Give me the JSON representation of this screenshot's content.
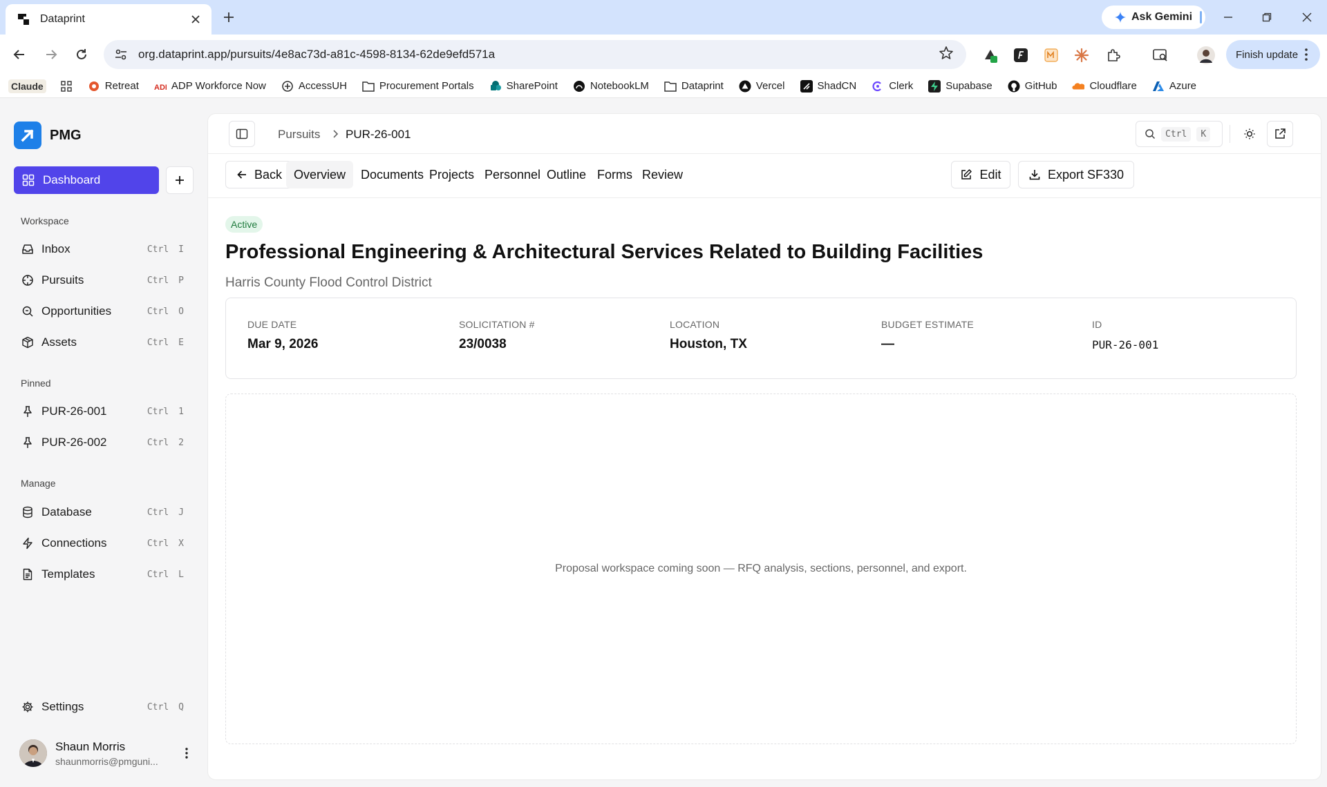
{
  "browser": {
    "tab_title": "Dataprint",
    "url": "org.dataprint.app/pursuits/4e8ac73d-a81c-4598-8134-62de9efd571a",
    "gemini_label": "Ask Gemini",
    "finish_update_label": "Finish update",
    "bookmarks": [
      "Claude",
      "Retreat",
      "ADP Workforce Now",
      "AccessUH",
      "Procurement Portals",
      "SharePoint",
      "NotebookLM",
      "Dataprint",
      "Vercel",
      "ShadCN",
      "Clerk",
      "Supabase",
      "GitHub",
      "Cloudflare",
      "Azure"
    ]
  },
  "sidebar": {
    "brand": "PMG",
    "dashboard_label": "Dashboard",
    "workspace_label": "Workspace",
    "workspace_items": [
      {
        "label": "Inbox",
        "mod": "Ctrl",
        "key": "I",
        "icon": "inbox-icon"
      },
      {
        "label": "Pursuits",
        "mod": "Ctrl",
        "key": "P",
        "icon": "crosshair-icon"
      },
      {
        "label": "Opportunities",
        "mod": "Ctrl",
        "key": "O",
        "icon": "search-icon"
      },
      {
        "label": "Assets",
        "mod": "Ctrl",
        "key": "E",
        "icon": "box-icon"
      }
    ],
    "pinned_label": "Pinned",
    "pinned_items": [
      {
        "label": "PUR-26-001",
        "mod": "Ctrl",
        "key": "1"
      },
      {
        "label": "PUR-26-002",
        "mod": "Ctrl",
        "key": "2"
      }
    ],
    "manage_label": "Manage",
    "manage_items": [
      {
        "label": "Database",
        "mod": "Ctrl",
        "key": "J",
        "icon": "database-icon"
      },
      {
        "label": "Connections",
        "mod": "Ctrl",
        "key": "X",
        "icon": "zap-icon"
      },
      {
        "label": "Templates",
        "mod": "Ctrl",
        "key": "L",
        "icon": "file-text-icon"
      }
    ],
    "settings": {
      "label": "Settings",
      "mod": "Ctrl",
      "key": "Q"
    },
    "user": {
      "name": "Shaun Morris",
      "email": "shaunmorris@pmguni..."
    }
  },
  "header": {
    "breadcrumb_root": "Pursuits",
    "breadcrumb_current": "PUR-26-001",
    "search_mod": "Ctrl",
    "search_key": "K"
  },
  "tabs": {
    "back_label": "Back",
    "items": [
      "Overview",
      "Documents",
      "Projects",
      "Personnel",
      "Outline",
      "Forms",
      "Review"
    ],
    "active": "Overview",
    "edit_label": "Edit",
    "export_label": "Export SF330"
  },
  "pursuit": {
    "status": "Active",
    "title": "Professional Engineering & Architectural Services Related to Building Facilities",
    "organization": "Harris County Flood Control District",
    "meta": [
      {
        "label": "DUE DATE",
        "value": "Mar 9, 2026"
      },
      {
        "label": "SOLICITATION #",
        "value": "23/0038"
      },
      {
        "label": "LOCATION",
        "value": "Houston, TX"
      },
      {
        "label": "BUDGET ESTIMATE",
        "value": "—"
      },
      {
        "label": "ID",
        "value": "PUR-26-001"
      }
    ],
    "workspace_message": "Proposal workspace coming soon — RFQ analysis, sections, personnel, and export."
  },
  "colors": {
    "accent": "#5144ea",
    "brand_logo": "#1e80e8",
    "status_bg": "#e3f6ea",
    "status_text": "#1e7a3c"
  }
}
